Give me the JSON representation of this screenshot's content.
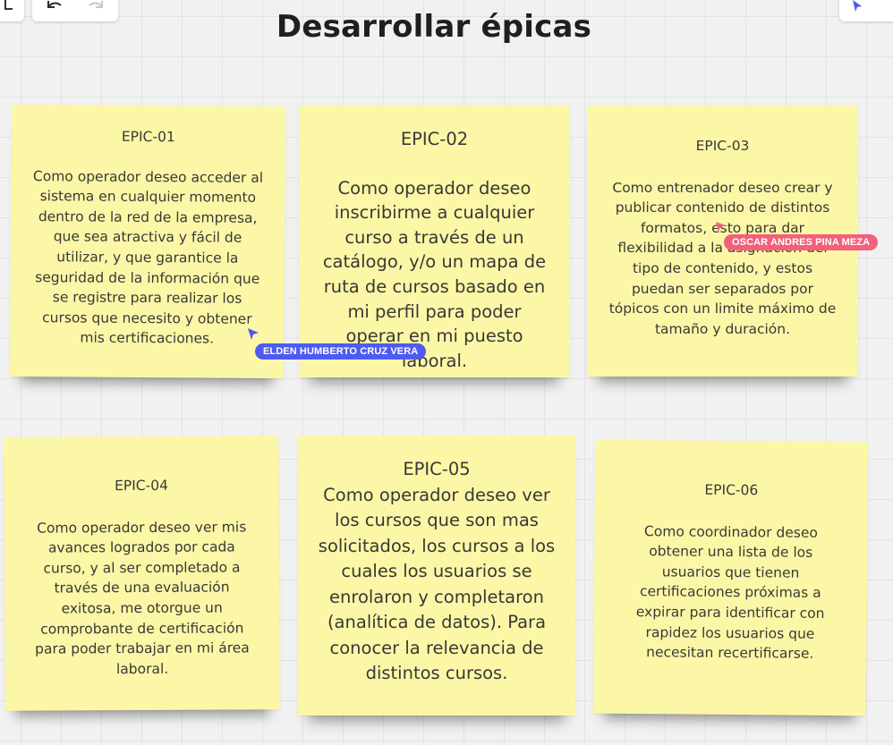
{
  "board": {
    "title": "Desarrollar épicas"
  },
  "notes": [
    {
      "id": "EPIC-01",
      "text": "Como operador deseo acceder al sistema en cualquier momento dentro de la red de la empresa, que sea atractiva y fácil de utilizar, y que garantice la seguridad de la información que se registre para realizar los cursos que necesito y obtener mis certificaciones."
    },
    {
      "id": "EPIC-02",
      "text": "Como operador deseo inscribirme a cualquier curso a través de un catálogo, y/o un mapa de ruta de cursos basado en mi perfil para poder operar en mi puesto laboral."
    },
    {
      "id": "EPIC-03",
      "text": "Como entrenador deseo crear y publicar contenido de distintos formatos, esto para dar flexibilidad a la asignación del tipo de contenido, y estos puedan ser separados por tópicos con un limite máximo de tamaño y duración."
    },
    {
      "id": "EPIC-04",
      "text": "Como operador deseo ver mis avances logrados por cada curso, y al ser completado a través de una evaluación exitosa, me otorgue un comprobante de certificación para poder trabajar en mi área laboral."
    },
    {
      "id": "EPIC-05",
      "text": "Como operador deseo ver los cursos que son mas solicitados, los cursos a los cuales los usuarios se enrolaron y completaron (analítica de datos). Para conocer la relevancia de distintos cursos."
    },
    {
      "id": "EPIC-06",
      "text": "Como coordinador deseo obtener una lista de los usuarios que tienen certificaciones próximas a expirar para identificar con rapidez los usuarios que necesitan recertificarse."
    }
  ],
  "collaborators": [
    {
      "name": "ELDEN HUMBERTO CRUZ VERA",
      "color": "#4e5bf2"
    },
    {
      "name": "OSCAR ANDRES PINA MEZA",
      "color": "#f2607a"
    }
  ],
  "toolbar": {
    "left_icon": "frame-corner-icon",
    "undo_icon": "undo-icon",
    "redo_icon": "redo-icon",
    "right_icon": "cursor-icon"
  },
  "colors": {
    "sticky": "#fcf7a6",
    "canvas": "#f1f1f1",
    "grid": "#e3e3e3"
  }
}
